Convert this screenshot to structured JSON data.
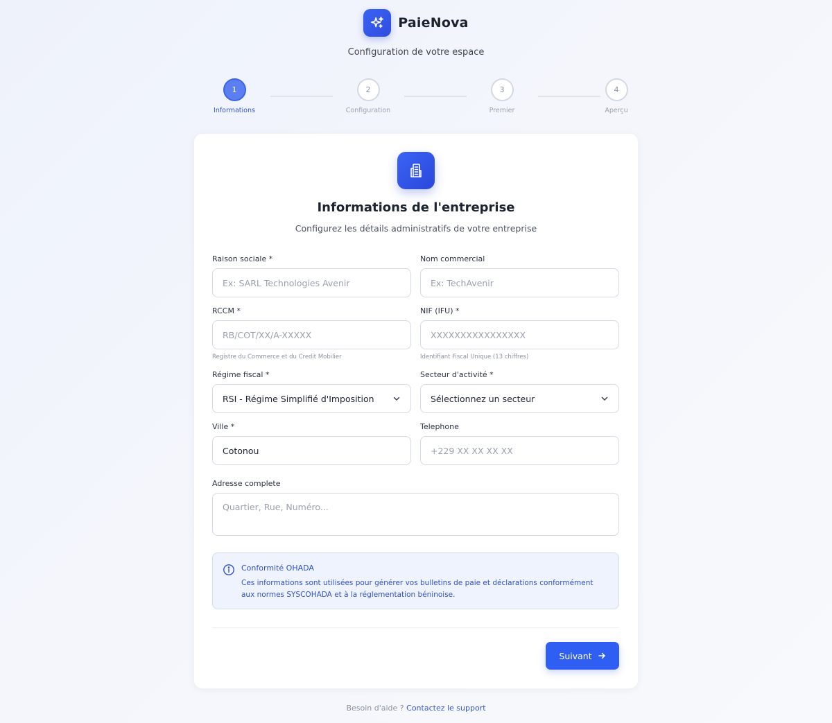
{
  "brand": {
    "name": "PaieNova",
    "logo_icon": "sparkles-icon"
  },
  "subtitle": "Configuration de votre espace",
  "steps": [
    {
      "number": "1",
      "label": "Informations",
      "active": true
    },
    {
      "number": "2",
      "label": "Configuration",
      "active": false
    },
    {
      "number": "3",
      "label": "Premier",
      "active": false
    },
    {
      "number": "4",
      "label": "Aperçu",
      "active": false
    }
  ],
  "card": {
    "icon": "building-icon",
    "title": "Informations de l'entreprise",
    "subtitle": "Configurez les détails administratifs de votre entreprise"
  },
  "form": {
    "raison_sociale": {
      "label": "Raison sociale *",
      "placeholder": "Ex: SARL Technologies Avenir",
      "value": ""
    },
    "nom_commercial": {
      "label": "Nom commercial",
      "placeholder": "Ex: TechAvenir",
      "value": ""
    },
    "rccm": {
      "label": "RCCM *",
      "placeholder": "RB/COT/XX/A-XXXXX",
      "value": "",
      "hint": "Registre du Commerce et du Credit Mobilier"
    },
    "nif": {
      "label": "NIF (IFU) *",
      "placeholder": "XXXXXXXXXXXXXXXX",
      "value": "",
      "hint": "Identifiant Fiscal Unique (13 chiffres)"
    },
    "regime_fiscal": {
      "label": "Régime fiscal *",
      "selected": "RSI - Régime Simplifié d'Imposition"
    },
    "secteur": {
      "label": "Secteur d'activité *",
      "selected": "Sélectionnez un secteur"
    },
    "ville": {
      "label": "Ville *",
      "value": "Cotonou"
    },
    "telephone": {
      "label": "Telephone",
      "placeholder": "+229 XX XX XX XX",
      "value": ""
    },
    "adresse": {
      "label": "Adresse complete",
      "placeholder": "Quartier, Rue, Numéro...",
      "value": ""
    }
  },
  "notice": {
    "icon": "info-icon",
    "title": "Conformité OHADA",
    "text": "Ces informations sont utilisées pour générer vos bulletins de paie et déclarations conformément aux normes SYSCOHADA et à la réglementation béninoise."
  },
  "actions": {
    "next_label": "Suivant",
    "next_icon": "arrow-right-icon"
  },
  "footer": {
    "prefix": "Besoin d'aide ?",
    "link": "Contactez le support"
  },
  "colors": {
    "accent": "#2f5ef2",
    "notice_bg": "#eef3fd",
    "notice_text": "#3452c8"
  }
}
